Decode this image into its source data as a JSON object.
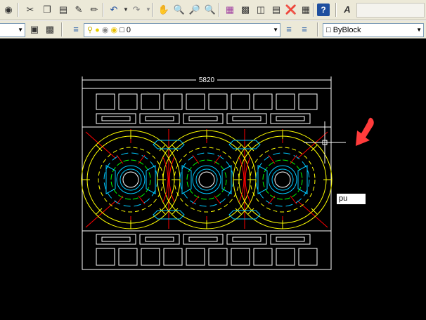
{
  "toolbar_standard": {
    "buttons": [
      "pan-realtime-icon",
      "scissors-icon",
      "copy-icon",
      "paste-icon",
      "brush-icon",
      "match-properties-icon",
      "undo-icon",
      "redo-icon",
      "pan-icon",
      "zoom-realtime-icon",
      "zoom-window-icon",
      "zoom-previous-icon",
      "properties-icon",
      "design-center-icon",
      "tool-palettes-icon",
      "sheet-set-icon",
      "markup-icon",
      "calculator-icon",
      "help-icon",
      "text-style-icon"
    ]
  },
  "toolbar_layers": {
    "layer_name": "0",
    "color_control": "ByBlock"
  },
  "drawing": {
    "dimension_text": "5820",
    "command_input": "pu"
  },
  "colors": {
    "background": "#000000",
    "white": "#ffffff",
    "yellow": "#ffff00",
    "cyan": "#00c8ff",
    "green": "#00ff00",
    "red": "#ff0000",
    "arrow": "#ff3b3b"
  }
}
